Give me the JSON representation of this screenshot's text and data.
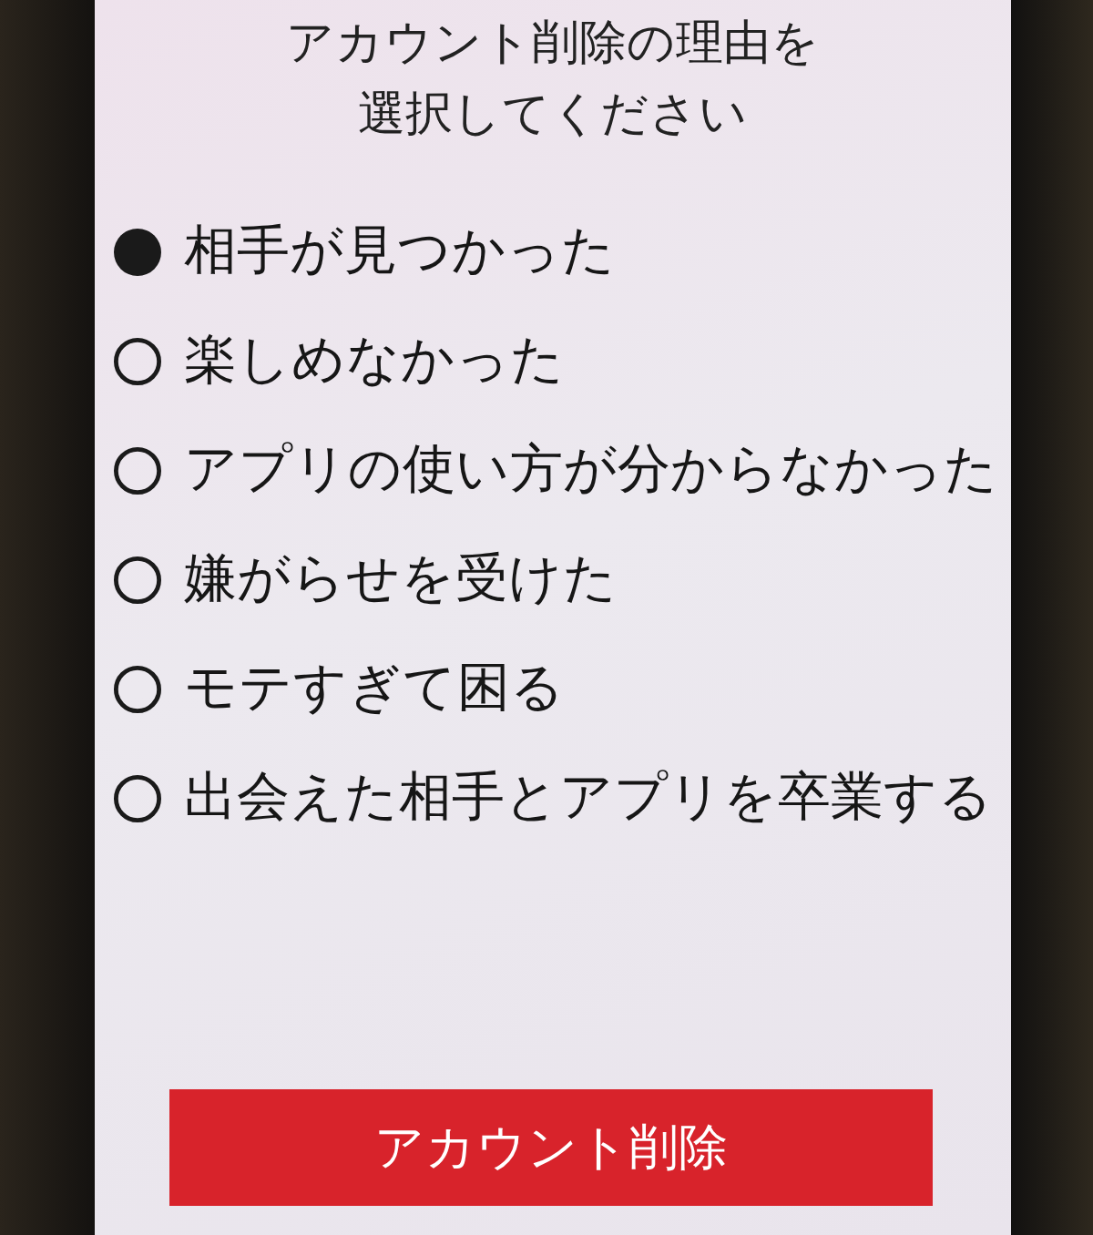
{
  "title": "アカウント削除の理由を選択してください",
  "reasons": [
    {
      "label": "相手が見つかった",
      "selected": true
    },
    {
      "label": "楽しめなかった",
      "selected": false
    },
    {
      "label": "アプリの使い方が分からなかった",
      "selected": false
    },
    {
      "label": "嫌がらせを受けた",
      "selected": false
    },
    {
      "label": "モテすぎて困る",
      "selected": false
    },
    {
      "label": "出会えた相手とアプリを卒業する",
      "selected": false
    }
  ],
  "button": {
    "label": "アカウント削除"
  }
}
